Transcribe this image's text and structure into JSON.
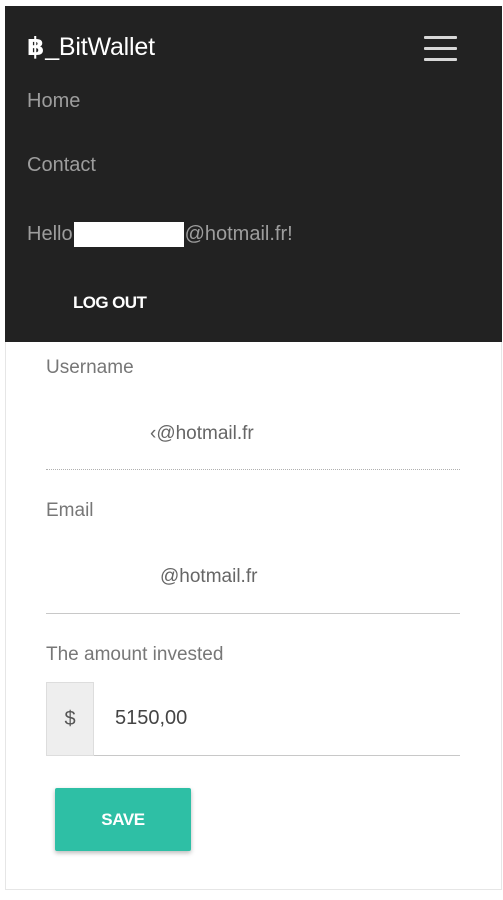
{
  "navbar": {
    "brand_icon": "฿",
    "brand_text": "_BitWallet",
    "links": [
      "Home",
      "Contact"
    ],
    "hello_prefix": "Hello",
    "hello_suffix": "@hotmail.fr!",
    "logout_label": "LOG OUT",
    "background_color": "#222222"
  },
  "form": {
    "username_label": "Username",
    "username_value": "‹@hotmail.fr",
    "email_label": "Email",
    "email_value": "@hotmail.fr",
    "amount_label": "The amount invested",
    "currency_symbol": "$",
    "amount_value": "5150,00",
    "save_label": "SAVE",
    "accent_color": "#2ebfa5"
  }
}
